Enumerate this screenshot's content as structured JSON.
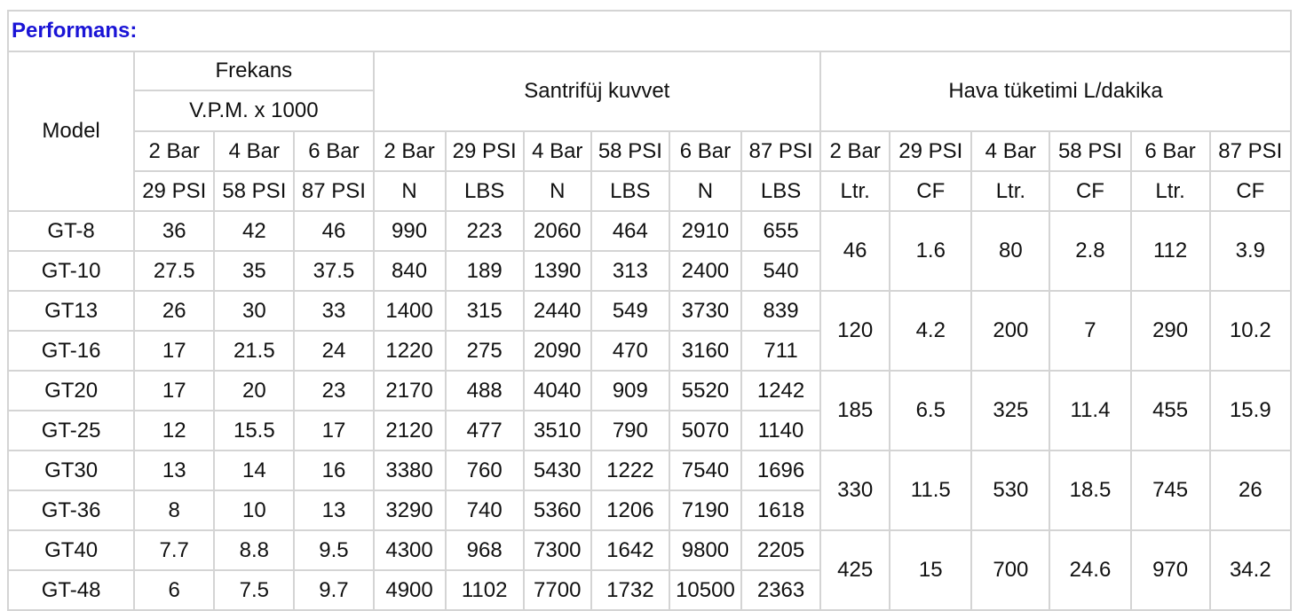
{
  "title": "Performans:",
  "header": {
    "model": "Model",
    "frekans": "Frekans",
    "vpm": "V.P.M. x 1000",
    "santrifuj": "Santrifüj kuvvet",
    "hava": "Hava tüketimi L/dakika",
    "frekans_bar": [
      "2 Bar",
      "4 Bar",
      "6 Bar"
    ],
    "frekans_psi": [
      "29 PSI",
      "58 PSI",
      "87 PSI"
    ],
    "santrifuj_top": [
      "2 Bar",
      "29 PSI",
      "4 Bar",
      "58 PSI",
      "6 Bar",
      "87 PSI"
    ],
    "santrifuj_unit": [
      "N",
      "LBS",
      "N",
      "LBS",
      "N",
      "LBS"
    ],
    "hava_top": [
      "2 Bar",
      "29 PSI",
      "4 Bar",
      "58 PSI",
      "6 Bar",
      "87 PSI"
    ],
    "hava_unit": [
      "Ltr.",
      "CF",
      "Ltr.",
      "CF",
      "Ltr.",
      "CF"
    ]
  },
  "rows": [
    {
      "model": "GT-8",
      "f": [
        "36",
        "42",
        "46"
      ],
      "s": [
        "990",
        "223",
        "2060",
        "464",
        "2910",
        "655"
      ]
    },
    {
      "model": "GT-10",
      "f": [
        "27.5",
        "35",
        "37.5"
      ],
      "s": [
        "840",
        "189",
        "1390",
        "313",
        "2400",
        "540"
      ]
    },
    {
      "model": "GT13",
      "f": [
        "26",
        "30",
        "33"
      ],
      "s": [
        "1400",
        "315",
        "2440",
        "549",
        "3730",
        "839"
      ]
    },
    {
      "model": "GT-16",
      "f": [
        "17",
        "21.5",
        "24"
      ],
      "s": [
        "1220",
        "275",
        "2090",
        "470",
        "3160",
        "711"
      ]
    },
    {
      "model": "GT20",
      "f": [
        "17",
        "20",
        "23"
      ],
      "s": [
        "2170",
        "488",
        "4040",
        "909",
        "5520",
        "1242"
      ]
    },
    {
      "model": "GT-25",
      "f": [
        "12",
        "15.5",
        "17"
      ],
      "s": [
        "2120",
        "477",
        "3510",
        "790",
        "5070",
        "1140"
      ]
    },
    {
      "model": "GT30",
      "f": [
        "13",
        "14",
        "16"
      ],
      "s": [
        "3380",
        "760",
        "5430",
        "1222",
        "7540",
        "1696"
      ]
    },
    {
      "model": "GT-36",
      "f": [
        "8",
        "10",
        "13"
      ],
      "s": [
        "3290",
        "740",
        "5360",
        "1206",
        "7190",
        "1618"
      ]
    },
    {
      "model": "GT40",
      "f": [
        "7.7",
        "8.8",
        "9.5"
      ],
      "s": [
        "4300",
        "968",
        "7300",
        "1642",
        "9800",
        "2205"
      ]
    },
    {
      "model": "GT-48",
      "f": [
        "6",
        "7.5",
        "9.7"
      ],
      "s": [
        "4900",
        "1102",
        "7700",
        "1732",
        "10500",
        "2363"
      ]
    }
  ],
  "hava_groups": [
    [
      "46",
      "1.6",
      "80",
      "2.8",
      "112",
      "3.9"
    ],
    [
      "120",
      "4.2",
      "200",
      "7",
      "290",
      "10.2"
    ],
    [
      "185",
      "6.5",
      "325",
      "11.4",
      "455",
      "15.9"
    ],
    [
      "330",
      "11.5",
      "530",
      "18.5",
      "745",
      "26"
    ],
    [
      "425",
      "15",
      "700",
      "24.6",
      "970",
      "34.2"
    ]
  ]
}
